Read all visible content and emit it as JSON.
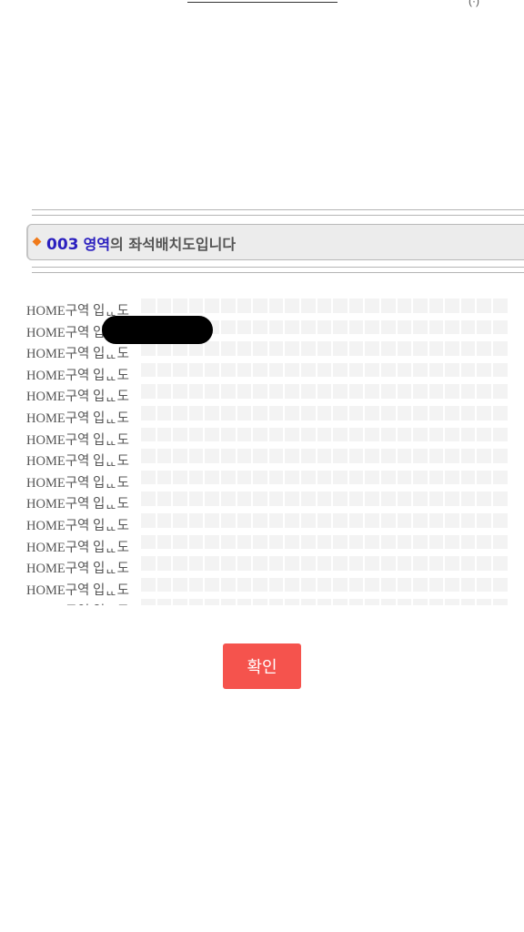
{
  "header": {
    "number": "003",
    "zone": "영역",
    "rest": "의 좌석배치도입니다"
  },
  "rows": [
    {
      "label": "HOME구역 입ᆫᆫ도"
    },
    {
      "label": "HOME구역 입ᆫᆫ도"
    },
    {
      "label": "HOME구역 입ᆫᆫ도"
    },
    {
      "label": "HOME구역 입ᆫᆫ도"
    },
    {
      "label": "HOME구역 입ᆫᆫ도"
    },
    {
      "label": "HOME구역 입ᆫᆫ도"
    },
    {
      "label": "HOME구역 입ᆫᆫ도"
    },
    {
      "label": "HOME구역 입ᆫᆫ도"
    },
    {
      "label": "HOME구역 입ᆫᆫ도"
    },
    {
      "label": "HOME구역 입ᆫᆫ도"
    },
    {
      "label": "HOME구역 입ᆫᆫ도"
    },
    {
      "label": "HOME구역 입ᆫᆫ도"
    },
    {
      "label": "HOME구역 입ᆫᆫ도"
    },
    {
      "label": "HOME구역 입ᆫᆫ도"
    },
    {
      "label": "HOME구역 입ᆫᆫ도"
    }
  ],
  "confirm_label": "확인",
  "colors": {
    "accent": "#2a1fbf",
    "bullet": "#f07a1a",
    "button": "#f5534d",
    "seat": "#f3f3f3"
  }
}
